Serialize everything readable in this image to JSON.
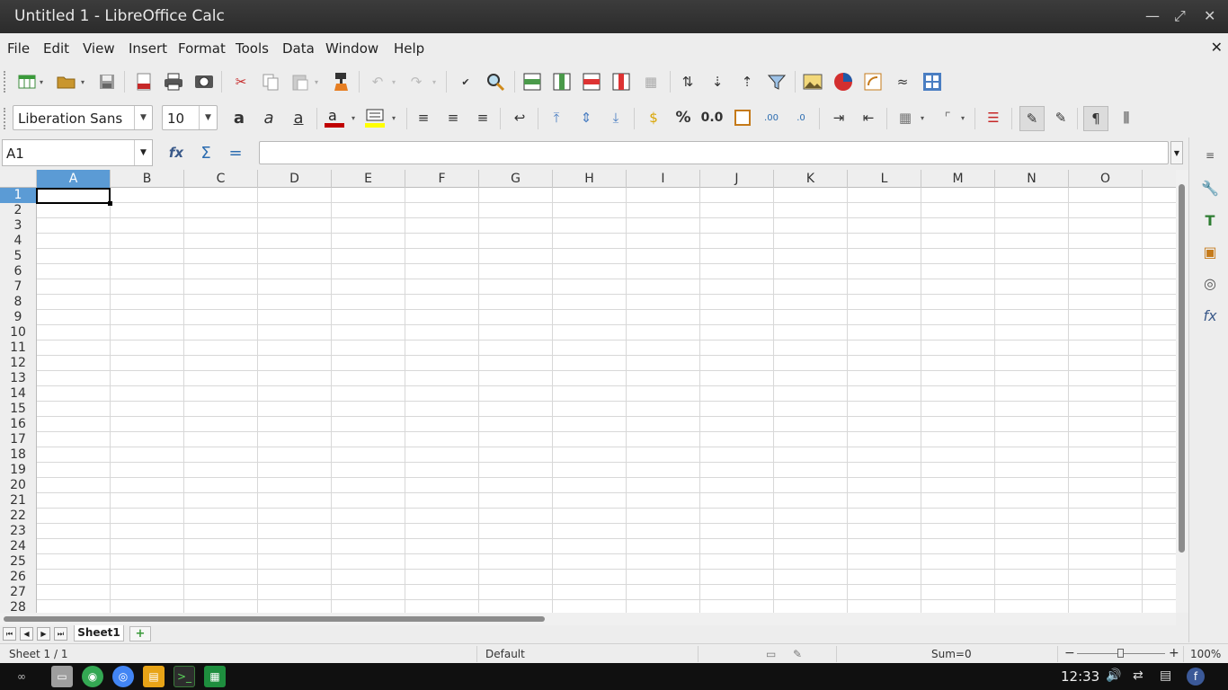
{
  "window": {
    "title": "Untitled 1 - LibreOffice Calc",
    "min_glyph": "—",
    "max_glyph": "⤢",
    "close_glyph": "✕"
  },
  "menu": {
    "items": [
      "File",
      "Edit",
      "View",
      "Insert",
      "Format",
      "Tools",
      "Data",
      "Window",
      "Help"
    ],
    "close_glyph": "✕"
  },
  "toolbar": {
    "standard_icons": [
      "new-icon",
      "open-icon",
      "save-icon",
      "export-pdf-icon",
      "print-icon",
      "print-preview-icon",
      "cut-icon",
      "copy-icon",
      "paste-icon",
      "clone-formatting-icon",
      "undo-icon",
      "redo-icon",
      "spelling-icon",
      "find-replace-icon",
      "row-icon",
      "column-icon",
      "delete-row-icon",
      "delete-column-icon",
      "merge-cells-icon",
      "sort-icon",
      "sort-ascending-icon",
      "sort-descending-icon",
      "autofilter-icon",
      "image-icon",
      "chart-icon",
      "pivot-table-icon",
      "special-character-icon",
      "navigator-icon"
    ],
    "font_name": "Liberation Sans",
    "font_size": "10",
    "bold": "a",
    "italic": "a",
    "underline": "a",
    "percent": "%",
    "number_format": "0.0",
    "font_color": "#c00000",
    "highlight_color": "#ffff00"
  },
  "formula_bar": {
    "name_box": "A1",
    "formula": ""
  },
  "grid": {
    "columns": [
      "A",
      "B",
      "C",
      "D",
      "E",
      "F",
      "G",
      "H",
      "I",
      "J",
      "K",
      "L",
      "M",
      "N",
      "O"
    ],
    "rows": [
      "1",
      "2",
      "3",
      "4",
      "5",
      "6",
      "7",
      "8",
      "9",
      "10",
      "11",
      "12",
      "13",
      "14",
      "15",
      "16",
      "17",
      "18",
      "19",
      "20",
      "21",
      "22",
      "23",
      "24",
      "25",
      "26",
      "27",
      "28"
    ],
    "selected_cell": "A1",
    "selection_color": "#5b9bd5"
  },
  "sheets": {
    "tabs": [
      "Sheet1"
    ],
    "add_glyph": "+"
  },
  "status": {
    "sheet_info": "Sheet 1 / 1",
    "page_style": "Default",
    "sum": "Sum=0",
    "zoom": "100%",
    "zoom_minus": "−",
    "zoom_plus": "+"
  },
  "taskbar": {
    "clock": "12:33"
  }
}
